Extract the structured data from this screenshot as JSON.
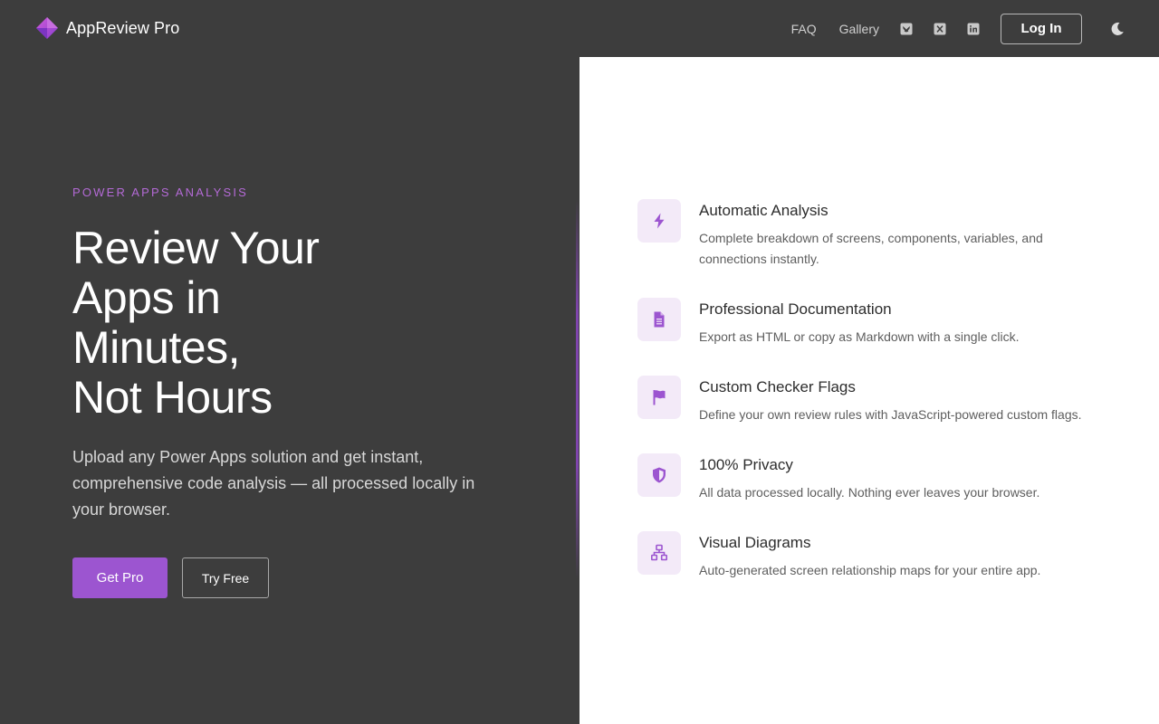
{
  "brand": {
    "name": "AppReview Pro",
    "logo_icon": "diamond-logo-icon"
  },
  "nav": {
    "faq": "FAQ",
    "gallery": "Gallery",
    "social": [
      "bluesky-icon",
      "x-icon",
      "linkedin-icon"
    ],
    "login": "Log In",
    "theme_toggle_icon": "moon-icon"
  },
  "hero": {
    "eyebrow": "POWER APPS ANALYSIS",
    "headline_lines": [
      "Review Your",
      "Apps in",
      "Minutes,",
      "Not Hours"
    ],
    "subtext": "Upload any Power Apps solution and get instant, comprehensive code analysis — all processed locally in your browser.",
    "primary_cta": "Get Pro",
    "secondary_cta": "Try Free"
  },
  "features": [
    {
      "icon": "bolt-icon",
      "title": "Automatic Analysis",
      "description": "Complete breakdown of screens, components, variables, and connections instantly."
    },
    {
      "icon": "document-icon",
      "title": "Professional Documentation",
      "description": "Export as HTML or copy as Markdown with a single click."
    },
    {
      "icon": "flag-icon",
      "title": "Custom Checker Flags",
      "description": "Define your own review rules with JavaScript-powered custom flags."
    },
    {
      "icon": "shield-icon",
      "title": "100% Privacy",
      "description": "All data processed locally. Nothing ever leaves your browser."
    },
    {
      "icon": "sitemap-icon",
      "title": "Visual Diagrams",
      "description": "Auto-generated screen relationship maps for your entire app."
    }
  ],
  "colors": {
    "background_dark": "#3d3d3d",
    "accent": "#9c55d0",
    "panel": "#ffffff",
    "icon_tint": "#f3eaf8"
  }
}
